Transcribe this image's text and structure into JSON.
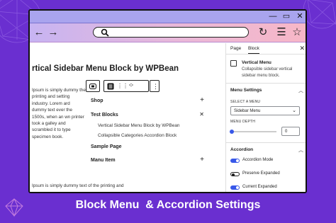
{
  "browser": {
    "window_controls": {
      "minimize": "—",
      "maximize": "▭",
      "close": "✕"
    },
    "back_icon": "arrow-left-icon",
    "forward_icon": "arrow-right-icon",
    "url": "",
    "toolbar_icons": [
      "reload-icon",
      "menu-icon",
      "star-icon"
    ]
  },
  "editor": {
    "post_title": "rtical Sidebar Menu Block by WPBean",
    "paragraph": "Ipsum is simply dummy the printing and setting industry. Lorem ard dummy text ever the 1500s, when an wn printer took a galley and scrambled it to type specimen book.",
    "footer_text": "Ipsum is simply dummy text of the printing and",
    "block_toolbar": [
      "block-type-icon",
      "drag-handle-icon",
      "move-arrows-icon",
      "more-options-icon"
    ],
    "menu_items": [
      {
        "label": "Shop",
        "control": "+"
      },
      {
        "label": "Test Blocks",
        "control": "✕",
        "children": [
          "Vertical Sidebar Menu Block by WPBean",
          "Collapsible Categories Accordion Block"
        ]
      },
      {
        "label": "Sample Page",
        "control": ""
      },
      {
        "label": "Manu Item",
        "control": "+"
      }
    ]
  },
  "sidebar": {
    "tabs": [
      "Page",
      "Block"
    ],
    "active_tab": "Block",
    "close_label": "✕",
    "block": {
      "name": "Vertical Menu",
      "description": "Collapsible sidebar vertical sidebar menu block."
    },
    "menu_settings": {
      "title": "Menu Settings",
      "select_label": "SELECT A MENU",
      "select_value": "Sidebar Menu",
      "depth_label": "MENU DEPTH",
      "depth_value": "0",
      "depth_fraction": 0
    },
    "accordion": {
      "title": "Accordion",
      "toggles": [
        {
          "label": "Accordion Mode",
          "on": true
        },
        {
          "label": "Preserve Expanded",
          "on": false
        },
        {
          "label": "Current Expanded",
          "on": true
        }
      ]
    }
  },
  "caption": "Block Menu  & Accordion Settings",
  "colors": {
    "background": "#6a2fd0",
    "accent": "#3858e9"
  }
}
